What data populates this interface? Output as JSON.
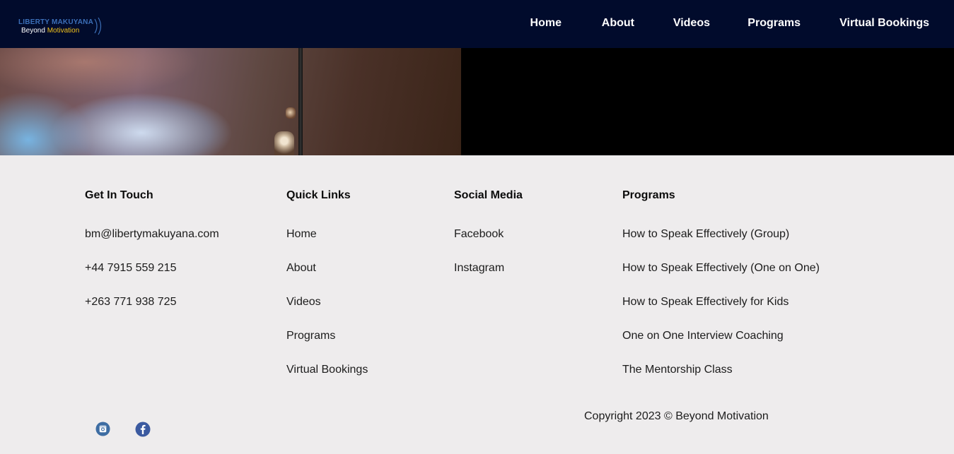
{
  "header": {
    "logo": {
      "top": "LIBERTY MAKUYANA",
      "bottom_start": "Beyond ",
      "bottom_accent": "Motivation"
    },
    "nav": [
      {
        "label": "Home"
      },
      {
        "label": "About"
      },
      {
        "label": "Videos"
      },
      {
        "label": "Programs"
      },
      {
        "label": "Virtual Bookings"
      }
    ]
  },
  "footer": {
    "get_in_touch": {
      "title": "Get In Touch",
      "items": [
        "bm@libertymakuyana.com",
        "+44 7915 559 215",
        "+263 771 938 725"
      ]
    },
    "quick_links": {
      "title": "Quick Links",
      "items": [
        "Home",
        "About",
        "Videos",
        "Programs",
        "Virtual Bookings"
      ]
    },
    "social_media": {
      "title": "Social Media",
      "items": [
        "Facebook",
        "Instagram"
      ]
    },
    "programs": {
      "title": "Programs",
      "items": [
        "How to Speak Effectively (Group)",
        "How to Speak Effectively (One on One)",
        "How to Speak Effectively for Kids",
        "One on One Interview Coaching",
        "The Mentorship Class"
      ]
    },
    "social_icons": [
      {
        "icon": "instagram-icon",
        "color": "#3e6da3"
      },
      {
        "icon": "facebook-icon",
        "color": "#3b5aa0"
      }
    ],
    "copyright": "Copyright 2023 © Beyond Motivation"
  },
  "colors": {
    "header_bg": "#010b2c",
    "footer_bg": "#eeeced",
    "logo_accent": "#f2c21b",
    "logo_blue": "#3c6fb8"
  }
}
